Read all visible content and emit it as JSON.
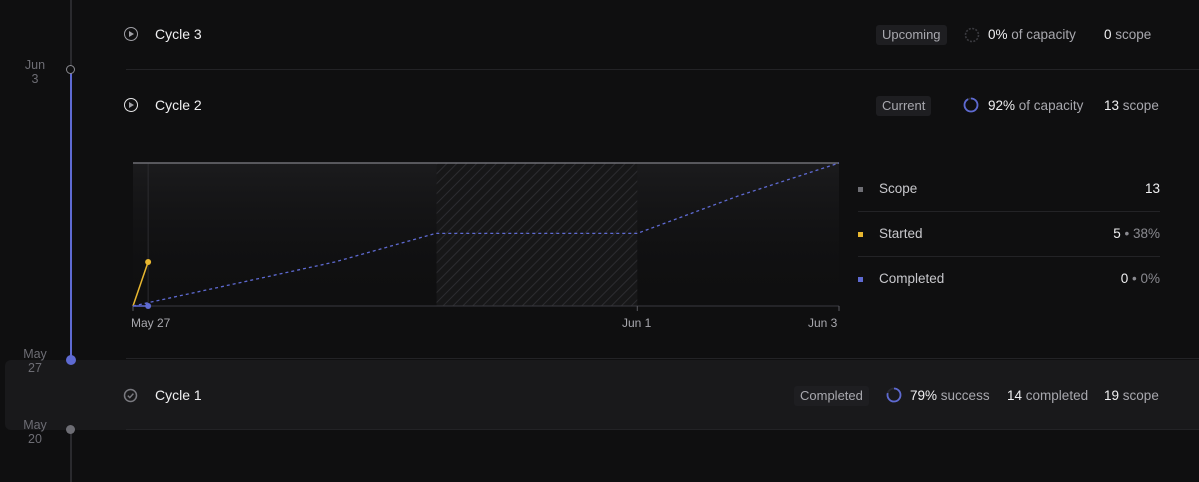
{
  "timeline": {
    "dates": [
      {
        "line1": "Jun",
        "line2": "3"
      },
      {
        "line1": "May",
        "line2": "27"
      },
      {
        "line1": "May",
        "line2": "20"
      }
    ]
  },
  "cycles": [
    {
      "title": "Cycle 3",
      "status": "Upcoming",
      "capacity_value": "0%",
      "capacity_label": "of capacity",
      "scope_value": "0",
      "scope_label": "scope"
    },
    {
      "title": "Cycle 2",
      "status": "Current",
      "capacity_value": "92%",
      "capacity_label": "of capacity",
      "scope_value": "13",
      "scope_label": "scope"
    },
    {
      "title": "Cycle 1",
      "status": "Completed",
      "success_value": "79%",
      "success_label": "success",
      "completed_value": "14",
      "completed_label": "completed",
      "scope_value": "19",
      "scope_label": "scope"
    }
  ],
  "legend": {
    "scope": {
      "label": "Scope",
      "value": "13",
      "color": "#6e6e74"
    },
    "started": {
      "label": "Started",
      "value": "5",
      "pct": "• 38%",
      "color": "#e8b730"
    },
    "completed": {
      "label": "Completed",
      "value": "0",
      "pct": "• 0%",
      "color": "#5e6ad2"
    }
  },
  "chart_data": {
    "type": "line",
    "x_ticks": [
      "May 27",
      "Jun 1",
      "Jun 3"
    ],
    "series": [
      {
        "name": "Scope",
        "color": "#6e6e74",
        "points": [
          [
            0,
            13
          ],
          [
            7,
            13
          ]
        ]
      },
      {
        "name": "Started",
        "color": "#e8b730",
        "points": [
          [
            0,
            0
          ],
          [
            0.15,
            4
          ]
        ]
      },
      {
        "name": "Completed",
        "color": "#5e6ad2",
        "points": [
          [
            0,
            0
          ],
          [
            0.15,
            0
          ]
        ]
      },
      {
        "name": "",
        "color": "#5e6ad2",
        "style": "dashed",
        "points": [
          [
            0,
            0
          ],
          [
            1,
            2
          ],
          [
            2,
            4
          ],
          [
            3,
            6.6
          ],
          [
            4,
            6.6
          ],
          [
            5,
            6.6
          ],
          [
            6,
            10
          ],
          [
            7,
            13
          ]
        ]
      }
    ],
    "weekend_shade": [
      3,
      5
    ],
    "ylim": [
      0,
      13
    ],
    "colors": {
      "accent": "#5e6ad2",
      "started": "#e8b730"
    }
  }
}
